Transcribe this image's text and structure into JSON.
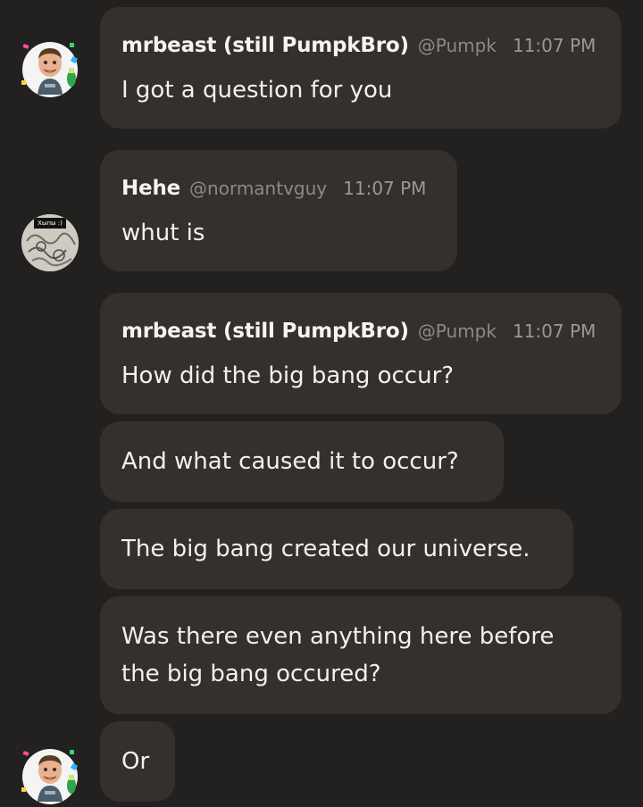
{
  "messages": [
    {
      "author": "mrbeast (still PumpkBro)",
      "handle": "@Pumpk",
      "time": "11:07 PM",
      "text": "I got a question for you"
    },
    {
      "author": "Hehe",
      "handle": "@normantvguy",
      "time": "11:07 PM",
      "text": "whut is",
      "avatar_caption": "Хыпы :)"
    },
    {
      "author": "mrbeast (still PumpkBro)",
      "handle": "@Pumpk",
      "time": "11:07 PM",
      "text": "How did the big bang occur?"
    },
    {
      "text": "And what caused it to occur?"
    },
    {
      "text": "The big bang created our universe."
    },
    {
      "text_line1": "Was there even anything here before",
      "text_line2": "the big bang occured?"
    },
    {
      "text": "Or"
    }
  ],
  "colors": {
    "background": "#232120",
    "bubble": "#33302e",
    "text": "#f3f1ef",
    "muted": "#9b9794"
  }
}
